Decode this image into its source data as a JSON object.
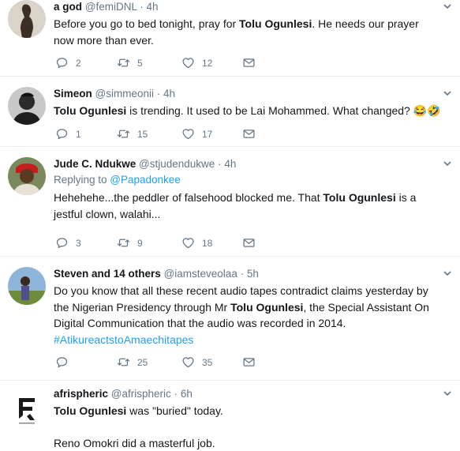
{
  "tweets": [
    {
      "name": "a god",
      "handle": "@femiDNL",
      "separator": "·",
      "time": "4h",
      "text_before": "Before you go to bed tonight, pray for ",
      "text_bold": "Tolu Ogunlesi",
      "text_after": ". He needs our prayer now more than ever.",
      "replies": "2",
      "retweets": "5",
      "likes": "12"
    },
    {
      "name": "Simeon",
      "handle": "@simmeonii",
      "separator": "·",
      "time": "4h",
      "text_bold": "Tolu Ogunlesi",
      "text_after": " is trending. It used to be Lai Mohammed.  What changed? 😂🤣",
      "replies": "1",
      "retweets": "15",
      "likes": "17"
    },
    {
      "name": "Jude C. Ndukwe",
      "handle": "@stjudendukwe",
      "separator": "·",
      "time": "4h",
      "replying_prefix": "Replying to ",
      "replying_to": "@Papadonkee",
      "text_before": "Hehehehe...the peddler of falsehood blocked me. That ",
      "text_bold": "Tolu Ogunlesi",
      "text_after": " is a jestful clown, walahi...",
      "replies": "3",
      "retweets": "9",
      "likes": "18"
    },
    {
      "name": "Steven and 14 others",
      "handle": "@iamsteveolaa",
      "separator": "·",
      "time": "5h",
      "text_before": "Do you know that all these  recent audio tapes contradict claims yesterday by the Nigerian Presidency through Mr ",
      "text_bold": "Tolu Ogunlesi",
      "text_after": ", the  Special Assistant On Digital Communication that the audio was recorded in 2014.",
      "hashtag": "#AtikureactstoAmaechitapes",
      "replies": "",
      "retweets": "25",
      "likes": "35"
    },
    {
      "name": "afrispheric",
      "handle": "@afrispheric",
      "separator": "·",
      "time": "6h",
      "text_bold": "Tolu Ogunlesi",
      "text_after": " was \"buried\" today.",
      "text_line2": "Reno Omokri did a masterful job."
    }
  ],
  "colors": {
    "accent": "#1da1f2",
    "muted": "#657786",
    "divider": "#e6ecf0"
  },
  "icons": [
    "reply-icon",
    "retweet-icon",
    "like-icon",
    "dm-icon",
    "chevron-down-icon"
  ]
}
